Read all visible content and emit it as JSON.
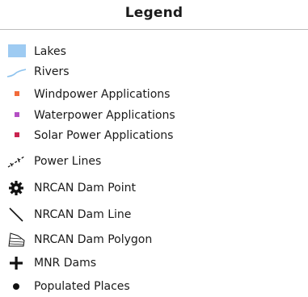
{
  "legend": {
    "title": "Legend",
    "items": [
      {
        "label": "Lakes",
        "icon": "lake-swatch-icon",
        "color": "#9ecbf2"
      },
      {
        "label": "Rivers",
        "icon": "river-line-icon",
        "color": "#8ec3ee"
      },
      {
        "label": "Windpower Applications",
        "icon": "square-marker-icon",
        "color": "#f26b3a"
      },
      {
        "label": "Waterpower Applications",
        "icon": "square-marker-icon",
        "color": "#b44fc4"
      },
      {
        "label": "Solar Power Applications",
        "icon": "square-marker-icon",
        "color": "#c9244f"
      },
      {
        "label": "Power Lines",
        "icon": "power-line-icon",
        "color": "#111111"
      },
      {
        "label": "NRCAN Dam Point",
        "icon": "gear-icon",
        "color": "#111111"
      },
      {
        "label": "NRCAN Dam Line",
        "icon": "diagonal-line-icon",
        "color": "#111111"
      },
      {
        "label": "NRCAN Dam Polygon",
        "icon": "dam-polygon-icon",
        "color": "#111111"
      },
      {
        "label": "MNR Dams",
        "icon": "plus-icon",
        "color": "#111111"
      },
      {
        "label": "Populated Places",
        "icon": "dot-icon",
        "color": "#111111"
      }
    ]
  }
}
